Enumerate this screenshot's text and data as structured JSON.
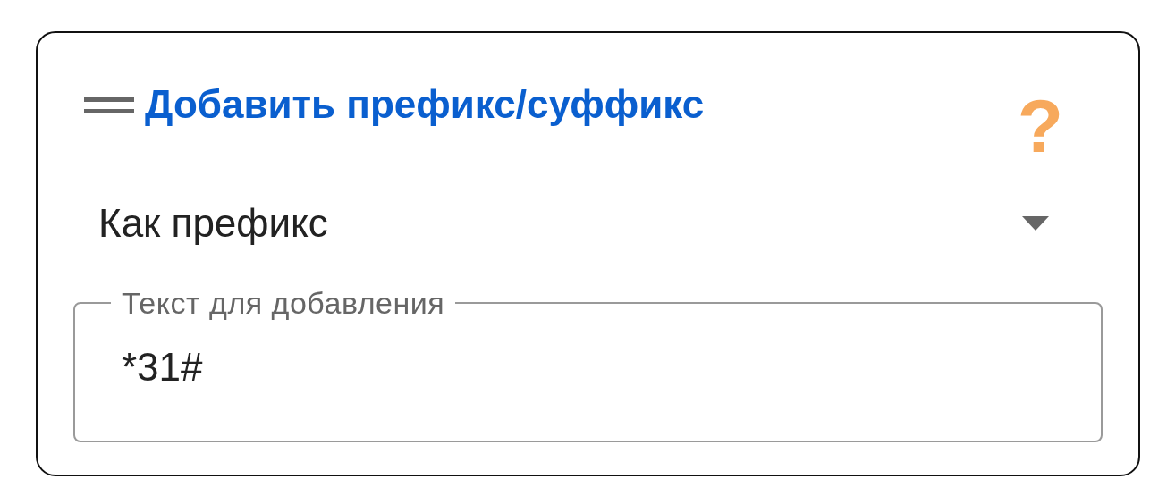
{
  "card": {
    "title": "Добавить префикс/суффикс",
    "help": "?"
  },
  "dropdown": {
    "value": "Как префикс"
  },
  "text_field": {
    "label": "Текст для добавления",
    "value": "*31#"
  }
}
